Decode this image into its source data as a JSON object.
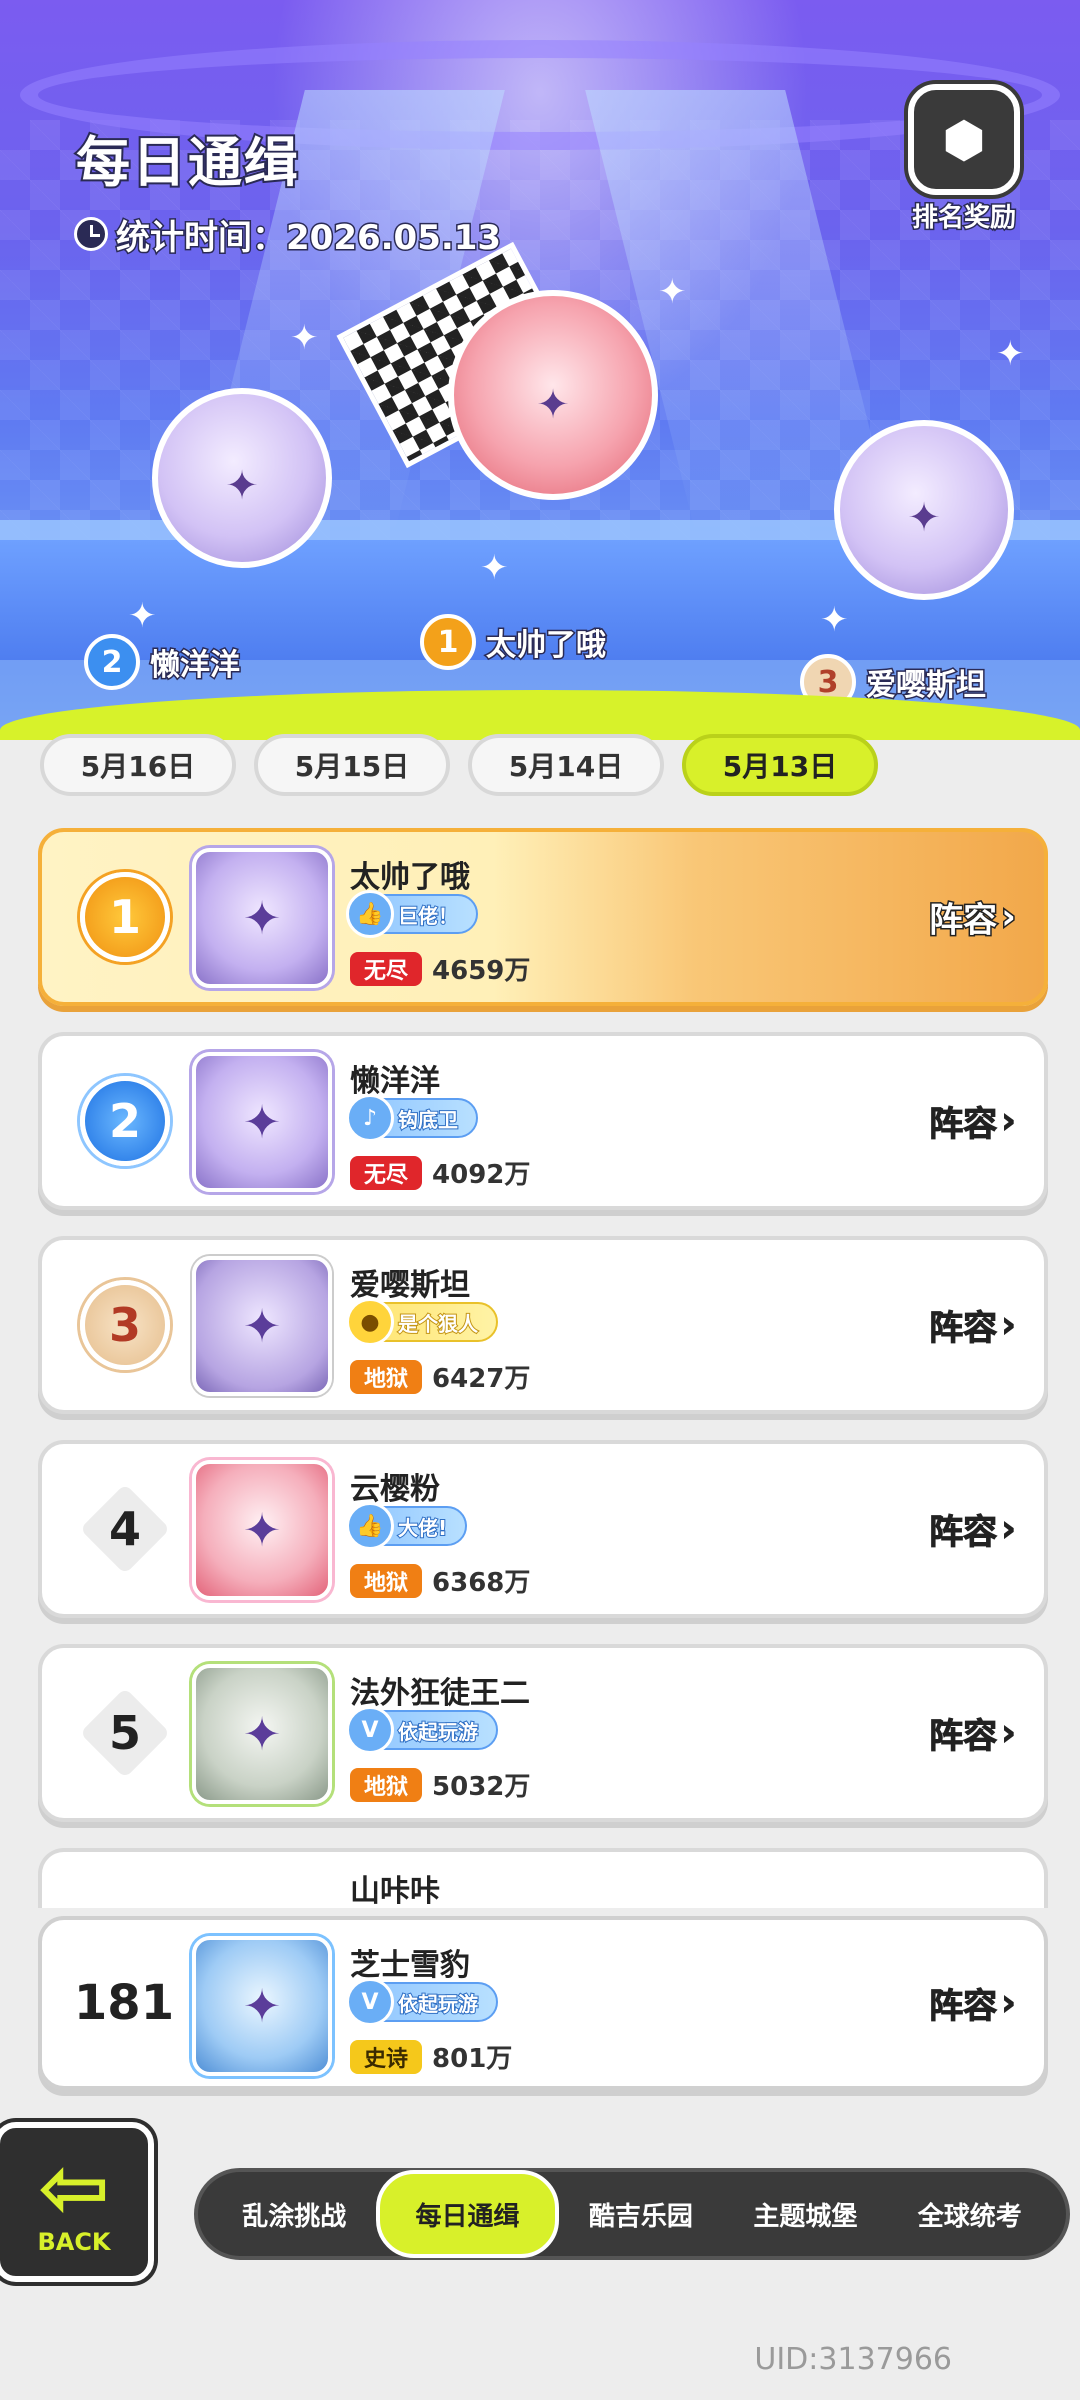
{
  "header": {
    "title": "每日通缉",
    "stat_label": "统计时间：2026.05.13",
    "reward_label": "排名奖励"
  },
  "podium": [
    {
      "rank": "1",
      "name": "太帅了哦"
    },
    {
      "rank": "2",
      "name": "懒洋洋"
    },
    {
      "rank": "3",
      "name": "爱嘤斯坦"
    }
  ],
  "date_tabs": [
    "5月16日",
    "5月15日",
    "5月14日",
    "5月13日"
  ],
  "active_date": "5月13日",
  "ranking": [
    {
      "rank": "1",
      "name": "太帅了哦",
      "title_tag": "巨佬！",
      "difficulty": "无尽",
      "score": "4659万",
      "lineup": "阵容"
    },
    {
      "rank": "2",
      "name": "懒洋洋",
      "title_tag": "钩底卫",
      "difficulty": "无尽",
      "score": "4092万",
      "lineup": "阵容"
    },
    {
      "rank": "3",
      "name": "爱嘤斯坦",
      "title_tag": "是个狠人",
      "difficulty": "地狱",
      "score": "6427万",
      "lineup": "阵容"
    },
    {
      "rank": "4",
      "name": "云樱粉",
      "title_tag": "大佬!",
      "difficulty": "地狱",
      "score": "6368万",
      "lineup": "阵容"
    },
    {
      "rank": "5",
      "name": "法外狂徒王二",
      "title_tag": "依起玩游",
      "difficulty": "地狱",
      "score": "5032万",
      "lineup": "阵容"
    }
  ],
  "partial_row": {
    "name": "山咔咔"
  },
  "self_row": {
    "rank": "181",
    "name": "芝士雪豹",
    "title_tag": "依起玩游",
    "difficulty": "史诗",
    "score": "801万",
    "lineup": "阵容"
  },
  "bottom_nav": {
    "back_label": "BACK",
    "items": [
      "乱涂挑战",
      "每日通缉",
      "酷吉乐园",
      "主题城堡",
      "全球统考"
    ],
    "active": "每日通缉"
  },
  "uid": "UID:3137966",
  "colors": {
    "accent_lime": "#d8f02a",
    "hero_purple": "#6b63ee",
    "difficulty_endless": "#e0262b",
    "difficulty_hell": "#f07f14",
    "difficulty_epic": "#f5c81b"
  }
}
